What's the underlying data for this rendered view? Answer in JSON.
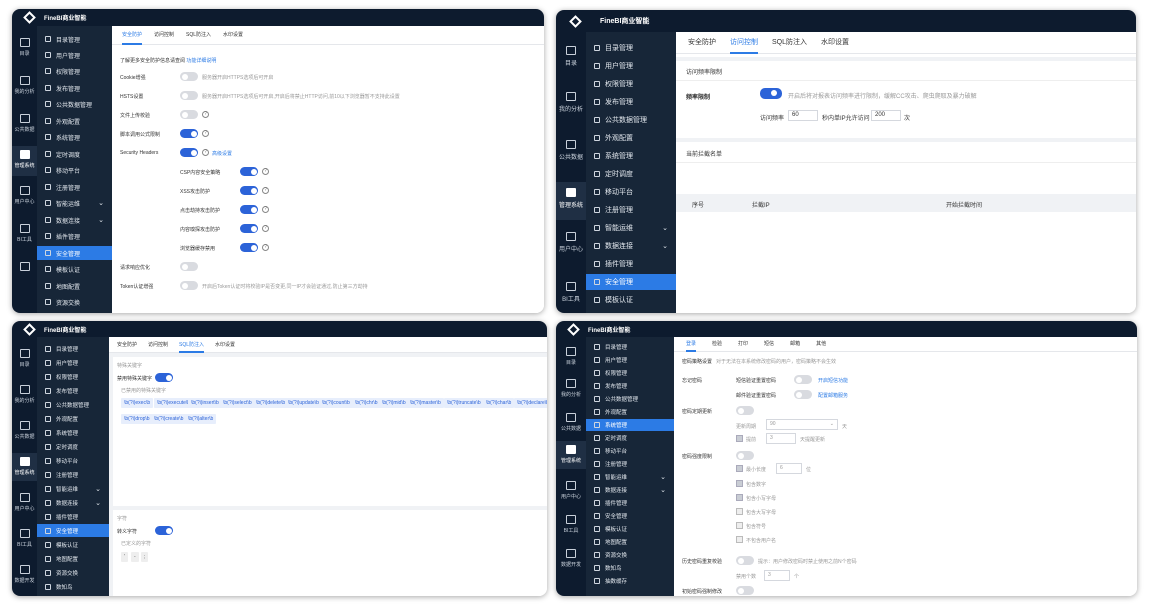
{
  "app_title": "FineBI商业智能",
  "rail": [
    "目录",
    "我的分析",
    "公共数据",
    "管理系统",
    "用户中心",
    "BI工具",
    "数据开发"
  ],
  "menu": [
    "目录管理",
    "用户管理",
    "权限管理",
    "发布管理",
    "公共数据管理",
    "外观配置",
    "系统管理",
    "定时调度",
    "移动平台",
    "注册管理",
    "智能运维",
    "数据连接",
    "插件管理",
    "安全管理",
    "模板认证",
    "地图配置",
    "资源交换",
    "数知鸟",
    "抽数缓存"
  ],
  "tabs1": [
    "安全防护",
    "访问控制",
    "SQL防注入",
    "水印设置"
  ],
  "tabs4": [
    "登录",
    "检验",
    "打印",
    "短信",
    "邮箱",
    "其他"
  ],
  "p1": {
    "intro": "了解更多安全防护信息请查阅",
    "intro_link": "功能详细说明",
    "rows": [
      {
        "label": "Cookie增强",
        "desc": "服务器开启HTTPS选项后可开启"
      },
      {
        "label": "HSTS设置",
        "desc": "服务器开启HTTPS选项后可开启,开启后将禁止HTTP访问,前10以下浏览器暂不支持此设置"
      },
      {
        "label": "文件上传校验",
        "desc": ""
      },
      {
        "label": "脚本调用公式限制",
        "desc": ""
      },
      {
        "label": "Security Headers",
        "desc": "高级设置"
      }
    ],
    "sub": [
      "CSP内容安全策略",
      "XSS攻击防护",
      "点击劫持攻击防护",
      "内容嗅探攻击防护",
      "浏览器缓存禁用"
    ],
    "rows2": [
      {
        "label": "请求响应优化",
        "desc": ""
      },
      {
        "label": "Token认证增强",
        "desc": "开启后Token认证时将校验IP是否变更,同一IP才会验证通过,防止第三方劫持"
      }
    ]
  },
  "p2": {
    "section1": "访问频率限制",
    "limit_label": "频率限制",
    "limit_desc": "开启后将对报表访问频率进行限制，缓解CC攻击、爬虫爬取及暴力破解",
    "freq_label": "访问频率",
    "freq_value": "60",
    "per_label": "秒内单IP允许访问",
    "count_value": "200",
    "count_unit": "次",
    "section2": "当前拦截名单",
    "columns": [
      "序号",
      "拦截IP",
      "开始拦截时间"
    ]
  },
  "p3": {
    "sec1": "特殊关键字",
    "ban_label": "禁用特殊关键字",
    "banned_label": "已禁用的特殊关键字",
    "chips": [
      "\\b(?i)exec\\b",
      "\\b(?i)execute\\b",
      "\\b(?i)insert\\b",
      "\\b(?i)select\\b",
      "\\b(?i)delete\\b",
      "\\b(?i)update\\b",
      "\\b(?i)count\\b",
      "\\b(?i)chr\\b",
      "\\b(?i)mid\\b",
      "\\b(?i)master\\b",
      "\\b(?i)truncate\\b",
      "\\b(?i)char\\b",
      "\\b(?i)declare\\b",
      "\\b(?i)drop\\b",
      "\\b(?i)create\\b",
      "\\b(?i)alter\\b"
    ],
    "sec2": "字符",
    "esc_label": "转义字符",
    "defined_label": "已定义的字符",
    "chars": [
      "'",
      "-",
      ";"
    ]
  },
  "p4": {
    "policy_label": "密码策略设置",
    "policy_desc": "对于无法在本系统修改密码的用户，密码策略不会生效",
    "forgot_label": "忘记密码",
    "sms_label": "短信验证重置密码",
    "sms_link": "开启短信功能",
    "email_label": "邮件验证重置密码",
    "email_link": "配置邮箱服务",
    "renew_label": "密码定期更新",
    "cycle_label": "更新周期",
    "cycle_value": "90",
    "cycle_unit": "天",
    "remind_label": "提前",
    "remind_value": "3",
    "remind_unit": "天提醒更新",
    "strength_label": "密码强度限制",
    "min_label": "最小长度",
    "min_value": "6",
    "min_unit": "位",
    "opts": [
      "包含数字",
      "包含小写字母",
      "包含大写字母",
      "包含符号",
      "不包含用户名"
    ],
    "history_label": "历史密码重复校验",
    "history_desc": "提示：用户修改密码时禁止使用之前N个密码",
    "history_n_label": "禁用个数",
    "history_n_value": "3",
    "history_n_unit": "个",
    "init_label": "初始密码强制修改"
  }
}
